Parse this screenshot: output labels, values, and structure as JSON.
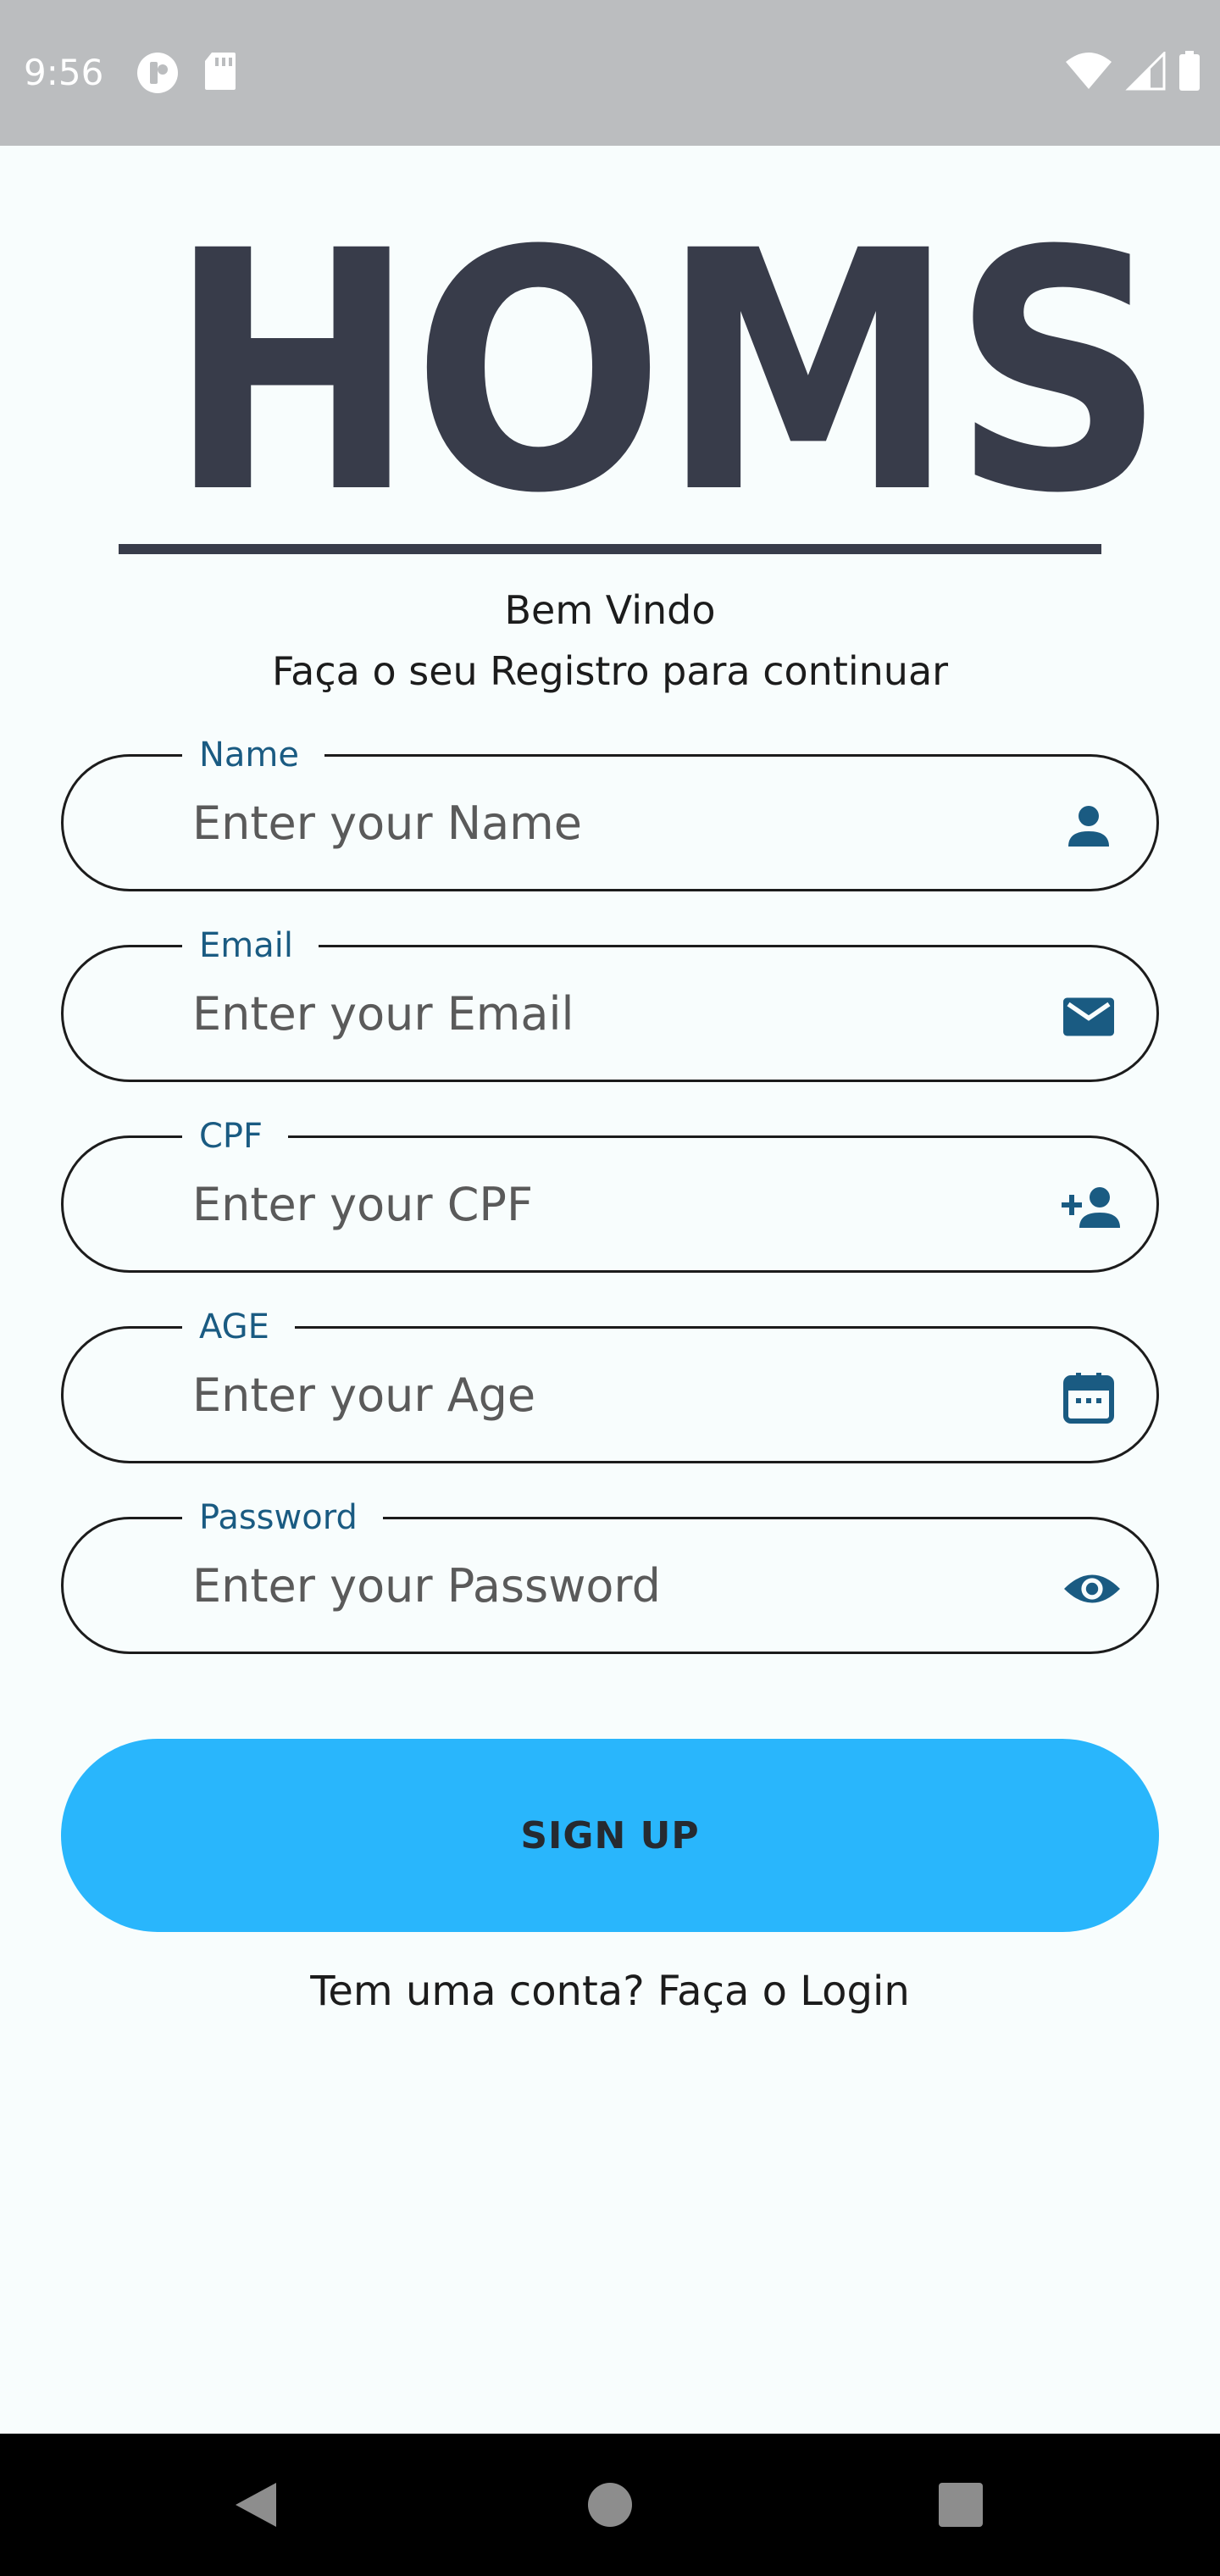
{
  "status_bar": {
    "time": "9:56",
    "icons": [
      "app-notification-icon",
      "sd-card-icon",
      "wifi-icon",
      "signal-icon",
      "battery-icon"
    ]
  },
  "logo": {
    "text": "HOMS"
  },
  "welcome": {
    "title": "Bem Vindo",
    "subtitle": "Faça o seu Registro para continuar"
  },
  "form": {
    "fields": [
      {
        "label": "Name",
        "placeholder": "Enter your Name",
        "value": "",
        "icon": "person-icon"
      },
      {
        "label": "Email",
        "placeholder": "Enter your Email",
        "value": "",
        "icon": "mail-icon"
      },
      {
        "label": "CPF",
        "placeholder": "Enter your CPF",
        "value": "",
        "icon": "person-add-icon"
      },
      {
        "label": "AGE",
        "placeholder": "Enter your Age",
        "value": "",
        "icon": "calendar-icon"
      },
      {
        "label": "Password",
        "placeholder": "Enter your Password",
        "value": "",
        "icon": "eye-icon"
      }
    ],
    "submit_label": "SIGN UP",
    "login_prompt": "Tem uma conta? Faça o Login"
  },
  "nav_bar": {
    "buttons": [
      "back-icon",
      "home-icon",
      "recents-icon"
    ]
  },
  "colors": {
    "accent": "#29b6fc",
    "label": "#1a5b82",
    "icon": "#1a5b82",
    "logo": "#383c4a",
    "background": "#f8fdfd",
    "status_bar": "#bbbdbf"
  }
}
